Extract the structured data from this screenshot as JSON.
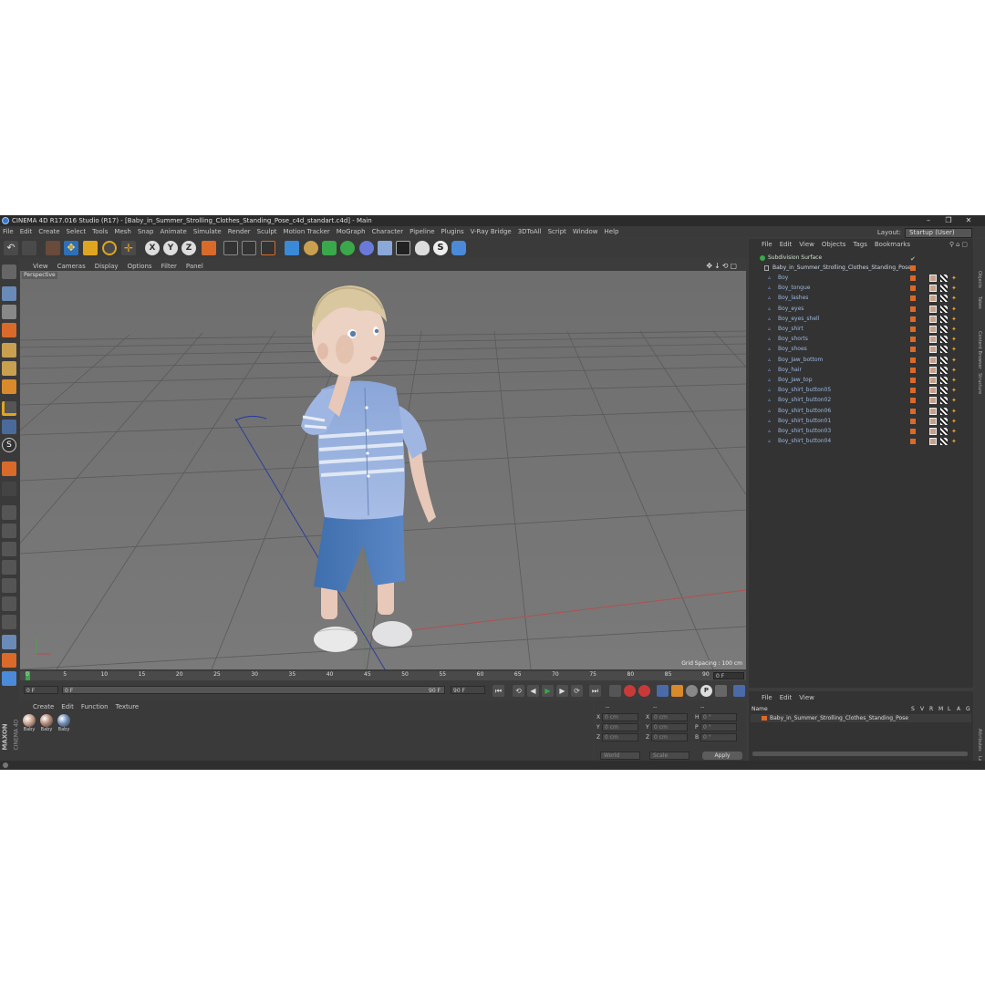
{
  "window": {
    "title": "CINEMA 4D R17.016 Studio (R17) - [Baby_in_Summer_Strolling_Clothes_Standing_Pose_c4d_standart.c4d] - Main",
    "min": "–",
    "max": "❐",
    "close": "✕"
  },
  "menubar": {
    "items": [
      "File",
      "Edit",
      "Create",
      "Select",
      "Tools",
      "Mesh",
      "Snap",
      "Animate",
      "Simulate",
      "Render",
      "Sculpt",
      "Motion Tracker",
      "MoGraph",
      "Character",
      "Pipeline",
      "Plugins",
      "V-Ray Bridge",
      "3DToAll",
      "Script",
      "Window",
      "Help"
    ],
    "layout_label": "Layout:",
    "layout_value": "Startup (User)"
  },
  "viewport": {
    "menu": [
      "View",
      "Cameras",
      "Display",
      "Options",
      "Filter",
      "Panel"
    ],
    "label": "Perspective",
    "grid_spacing": "Grid Spacing : 100 cm"
  },
  "timeline": {
    "ticks": [
      "0",
      "5",
      "10",
      "15",
      "20",
      "25",
      "30",
      "35",
      "40",
      "45",
      "50",
      "55",
      "60",
      "65",
      "70",
      "75",
      "80",
      "85",
      "90"
    ],
    "current_frame": "0 F",
    "start": "0 F",
    "range_start": "0 F",
    "range_end": "90 F",
    "end": "90 F"
  },
  "material": {
    "menu": [
      "Create",
      "Edit",
      "Function",
      "Texture"
    ],
    "items": [
      {
        "label": "Baby",
        "color": "#c9a18e"
      },
      {
        "label": "Baby",
        "color": "#b58a78"
      },
      {
        "label": "Baby",
        "color": "#6f8db8"
      }
    ]
  },
  "coords": {
    "header": [
      "--",
      "--",
      "--"
    ],
    "rows": [
      {
        "a": "X",
        "av": "0 cm",
        "b": "X",
        "bv": "0 cm",
        "c": "H",
        "cv": "0 °"
      },
      {
        "a": "Y",
        "av": "0 cm",
        "b": "Y",
        "bv": "0 cm",
        "c": "P",
        "cv": "0 °"
      },
      {
        "a": "Z",
        "av": "0 cm",
        "b": "Z",
        "bv": "0 cm",
        "c": "B",
        "cv": "0 °"
      }
    ],
    "mode1": "World",
    "mode2": "Scale",
    "apply": "Apply"
  },
  "objects": {
    "menu": [
      "File",
      "Edit",
      "View",
      "Objects",
      "Tags",
      "Bookmarks"
    ],
    "root": "Subdivision Surface",
    "group": "Baby_in_Summer_Strolling_Clothes_Standing_Pose",
    "children": [
      "Boy",
      "Boy_tongue",
      "Boy_lashes",
      "Boy_eyes",
      "Boy_eyes_shell",
      "Boy_shirt",
      "Boy_shorts",
      "Boy_shoes",
      "Boy_Jaw_bottom",
      "Boy_hair",
      "Boy_Jaw_top",
      "Boy_shirt_button05",
      "Boy_shirt_button02",
      "Boy_shirt_button06",
      "Boy_shirt_button01",
      "Boy_shirt_button03",
      "Boy_shirt_button04"
    ]
  },
  "attributes": {
    "menu": [
      "File",
      "Edit",
      "View"
    ],
    "col_name": "Name",
    "cols": [
      "S",
      "V",
      "R",
      "M",
      "L",
      "A",
      "G"
    ],
    "row": "Baby_in_Summer_Strolling_Clothes_Standing_Pose"
  },
  "sidetabs": [
    "Objects",
    "Takes",
    "Content Browser",
    "Structure"
  ],
  "sidetabs_bottom": [
    "Attributes",
    "Layers"
  ],
  "brand": {
    "t1": "MAXON",
    "t2": "CINEMA 4D"
  },
  "colors": {
    "accent": "#d96a2a",
    "object_text": "#9cb8e0",
    "viewport_bg": "#747474"
  }
}
